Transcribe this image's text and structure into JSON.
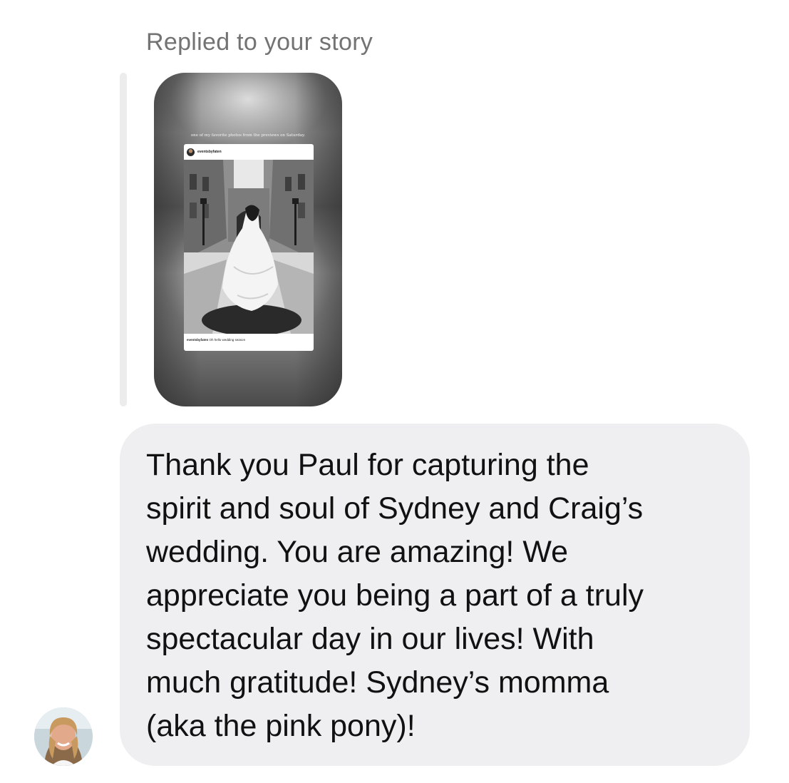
{
  "reply_header": "Replied to your story",
  "story": {
    "caption": "one of my favorite photos from the previews on Saturday.",
    "post": {
      "username": "eventsbyfaten",
      "caption_user": "eventsbyfaten",
      "caption_text": "Oh hello wedding season"
    }
  },
  "message": {
    "text": "Thank you Paul for capturing the\nspirit and soul of Sydney and Craig’s\nwedding.  You are amazing!  We\nappreciate you being a part of a truly\nspectacular day in our lives!  With\nmuch gratitude! Sydney’s momma\n(aka the pink pony)!"
  },
  "colors": {
    "bubble": "#efeff1",
    "header_text": "#737373",
    "message_text": "#111111"
  }
}
